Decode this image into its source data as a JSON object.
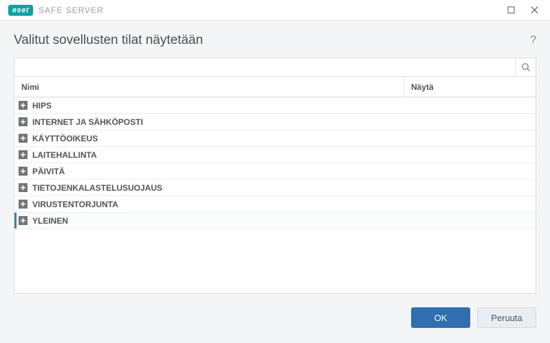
{
  "brand": {
    "badge": "eset",
    "product": "SAFE SERVER"
  },
  "page_title": "Valitut sovellusten tilat näytetään",
  "search": {
    "value": "",
    "placeholder": ""
  },
  "columns": {
    "name": "Nimi",
    "show": "Näytä"
  },
  "groups": [
    {
      "label": "HIPS",
      "selected": false
    },
    {
      "label": "INTERNET JA SÄHKÖPOSTI",
      "selected": false
    },
    {
      "label": "KÄYTTÖOIKEUS",
      "selected": false
    },
    {
      "label": "LAITEHALLINTA",
      "selected": false
    },
    {
      "label": "PÄIVITÄ",
      "selected": false
    },
    {
      "label": "TIETOJENKALASTELUSUOJAUS",
      "selected": false
    },
    {
      "label": "VIRUSTENTORJUNTA",
      "selected": false
    },
    {
      "label": "YLEINEN",
      "selected": true
    }
  ],
  "buttons": {
    "ok": "OK",
    "cancel": "Peruuta"
  },
  "help_glyph": "?"
}
